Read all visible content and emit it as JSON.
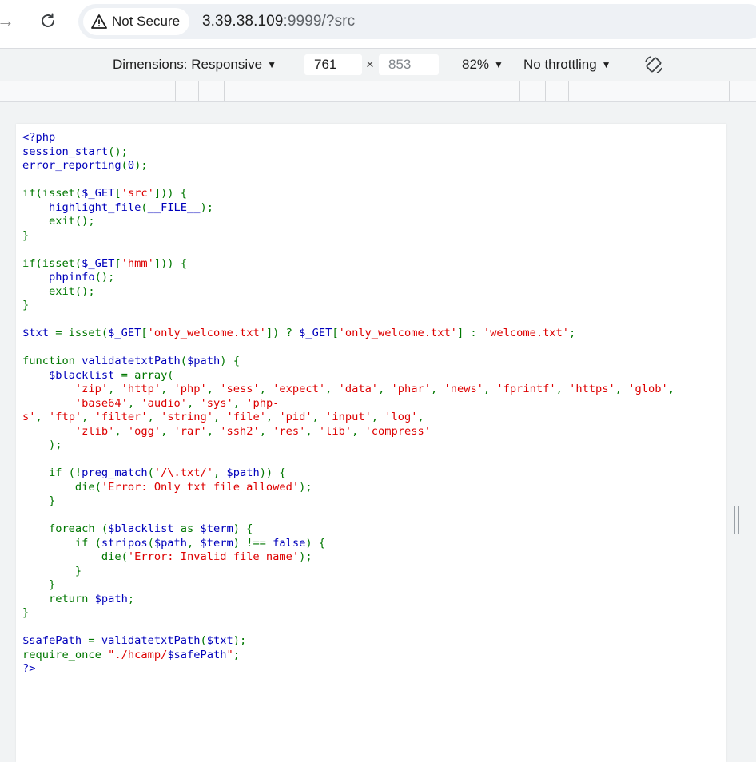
{
  "browser": {
    "security_label": "Not Secure",
    "url_host": "3.39.38.109",
    "url_rest": ":9999/?src"
  },
  "device_toolbar": {
    "dimensions_label": "Dimensions: Responsive",
    "width_value": "761",
    "times": "×",
    "height_value": "853",
    "zoom_label": "82%",
    "throttling_label": "No throttling"
  },
  "code_lines": [
    [
      [
        "d",
        "<?php"
      ]
    ],
    [
      [
        "d",
        "session_start"
      ],
      [
        "k",
        "();"
      ]
    ],
    [
      [
        "d",
        "error_reporting"
      ],
      [
        "k",
        "("
      ],
      [
        "d",
        "0"
      ],
      [
        "k",
        ");"
      ]
    ],
    [],
    [
      [
        "k",
        "if(isset("
      ],
      [
        "d",
        "$_GET"
      ],
      [
        "k",
        "["
      ],
      [
        "s",
        "'src'"
      ],
      [
        "k",
        "])) {"
      ]
    ],
    [
      [
        "k",
        "    "
      ],
      [
        "d",
        "highlight_file"
      ],
      [
        "k",
        "("
      ],
      [
        "d",
        "__FILE__"
      ],
      [
        "k",
        ");"
      ]
    ],
    [
      [
        "k",
        "    exit();"
      ]
    ],
    [
      [
        "k",
        "}"
      ]
    ],
    [],
    [
      [
        "k",
        "if(isset("
      ],
      [
        "d",
        "$_GET"
      ],
      [
        "k",
        "["
      ],
      [
        "s",
        "'hmm'"
      ],
      [
        "k",
        "])) {"
      ]
    ],
    [
      [
        "k",
        "    "
      ],
      [
        "d",
        "phpinfo"
      ],
      [
        "k",
        "();"
      ]
    ],
    [
      [
        "k",
        "    exit();"
      ]
    ],
    [
      [
        "k",
        "}"
      ]
    ],
    [],
    [
      [
        "d",
        "$txt "
      ],
      [
        "k",
        "= isset("
      ],
      [
        "d",
        "$_GET"
      ],
      [
        "k",
        "["
      ],
      [
        "s",
        "'only_welcome.txt'"
      ],
      [
        "k",
        "]) ? "
      ],
      [
        "d",
        "$_GET"
      ],
      [
        "k",
        "["
      ],
      [
        "s",
        "'only_welcome.txt'"
      ],
      [
        "k",
        "] : "
      ],
      [
        "s",
        "'welcome.txt'"
      ],
      [
        "k",
        ";"
      ]
    ],
    [],
    [
      [
        "k",
        "function "
      ],
      [
        "d",
        "validatetxtPath"
      ],
      [
        "k",
        "("
      ],
      [
        "d",
        "$path"
      ],
      [
        "k",
        ") {"
      ]
    ],
    [
      [
        "k",
        "    "
      ],
      [
        "d",
        "$blacklist "
      ],
      [
        "k",
        "= array("
      ]
    ],
    [
      [
        "k",
        "        "
      ],
      [
        "s",
        "'zip'"
      ],
      [
        "k",
        ", "
      ],
      [
        "s",
        "'http'"
      ],
      [
        "k",
        ", "
      ],
      [
        "s",
        "'php'"
      ],
      [
        "k",
        ", "
      ],
      [
        "s",
        "'sess'"
      ],
      [
        "k",
        ", "
      ],
      [
        "s",
        "'expect'"
      ],
      [
        "k",
        ", "
      ],
      [
        "s",
        "'data'"
      ],
      [
        "k",
        ", "
      ],
      [
        "s",
        "'phar'"
      ],
      [
        "k",
        ", "
      ],
      [
        "s",
        "'news'"
      ],
      [
        "k",
        ", "
      ],
      [
        "s",
        "'fprintf'"
      ],
      [
        "k",
        ", "
      ],
      [
        "s",
        "'https'"
      ],
      [
        "k",
        ", "
      ],
      [
        "s",
        "'glob'"
      ],
      [
        "k",
        ","
      ]
    ],
    [
      [
        "k",
        "        "
      ],
      [
        "s",
        "'base64'"
      ],
      [
        "k",
        ", "
      ],
      [
        "s",
        "'audio'"
      ],
      [
        "k",
        ", "
      ],
      [
        "s",
        "'sys'"
      ],
      [
        "k",
        ", "
      ],
      [
        "s",
        "'php-"
      ]
    ],
    [
      [
        "s",
        "s'"
      ],
      [
        "k",
        ", "
      ],
      [
        "s",
        "'ftp'"
      ],
      [
        "k",
        ", "
      ],
      [
        "s",
        "'filter'"
      ],
      [
        "k",
        ", "
      ],
      [
        "s",
        "'string'"
      ],
      [
        "k",
        ", "
      ],
      [
        "s",
        "'file'"
      ],
      [
        "k",
        ", "
      ],
      [
        "s",
        "'pid'"
      ],
      [
        "k",
        ", "
      ],
      [
        "s",
        "'input'"
      ],
      [
        "k",
        ", "
      ],
      [
        "s",
        "'log'"
      ],
      [
        "k",
        ","
      ]
    ],
    [
      [
        "k",
        "        "
      ],
      [
        "s",
        "'zlib'"
      ],
      [
        "k",
        ", "
      ],
      [
        "s",
        "'ogg'"
      ],
      [
        "k",
        ", "
      ],
      [
        "s",
        "'rar'"
      ],
      [
        "k",
        ", "
      ],
      [
        "s",
        "'ssh2'"
      ],
      [
        "k",
        ", "
      ],
      [
        "s",
        "'res'"
      ],
      [
        "k",
        ", "
      ],
      [
        "s",
        "'lib'"
      ],
      [
        "k",
        ", "
      ],
      [
        "s",
        "'compress'"
      ]
    ],
    [
      [
        "k",
        "    );"
      ]
    ],
    [],
    [
      [
        "k",
        "    if (!"
      ],
      [
        "d",
        "preg_match"
      ],
      [
        "k",
        "("
      ],
      [
        "s",
        "'/\\.txt/'"
      ],
      [
        "k",
        ", "
      ],
      [
        "d",
        "$path"
      ],
      [
        "k",
        ")) {"
      ]
    ],
    [
      [
        "k",
        "        die("
      ],
      [
        "s",
        "'Error: Only txt file allowed'"
      ],
      [
        "k",
        ");"
      ]
    ],
    [
      [
        "k",
        "    }"
      ]
    ],
    [],
    [
      [
        "k",
        "    foreach ("
      ],
      [
        "d",
        "$blacklist "
      ],
      [
        "k",
        "as "
      ],
      [
        "d",
        "$term"
      ],
      [
        "k",
        ") {"
      ]
    ],
    [
      [
        "k",
        "        if ("
      ],
      [
        "d",
        "stripos"
      ],
      [
        "k",
        "("
      ],
      [
        "d",
        "$path"
      ],
      [
        "k",
        ", "
      ],
      [
        "d",
        "$term"
      ],
      [
        "k",
        ") !== "
      ],
      [
        "d",
        "false"
      ],
      [
        "k",
        ") {"
      ]
    ],
    [
      [
        "k",
        "            die("
      ],
      [
        "s",
        "'Error: Invalid file name'"
      ],
      [
        "k",
        ");"
      ]
    ],
    [
      [
        "k",
        "        }"
      ]
    ],
    [
      [
        "k",
        "    }"
      ]
    ],
    [
      [
        "k",
        "    return "
      ],
      [
        "d",
        "$path"
      ],
      [
        "k",
        ";"
      ]
    ],
    [
      [
        "k",
        "}"
      ]
    ],
    [],
    [
      [
        "d",
        "$safePath "
      ],
      [
        "k",
        "= "
      ],
      [
        "d",
        "validatetxtPath"
      ],
      [
        "k",
        "("
      ],
      [
        "d",
        "$txt"
      ],
      [
        "k",
        ");"
      ]
    ],
    [
      [
        "k",
        "require_once "
      ],
      [
        "s",
        "\"./hcamp/"
      ],
      [
        "d",
        "$safePath"
      ],
      [
        "s",
        "\""
      ],
      [
        "k",
        ";"
      ]
    ],
    [
      [
        "d",
        "?>"
      ]
    ]
  ]
}
